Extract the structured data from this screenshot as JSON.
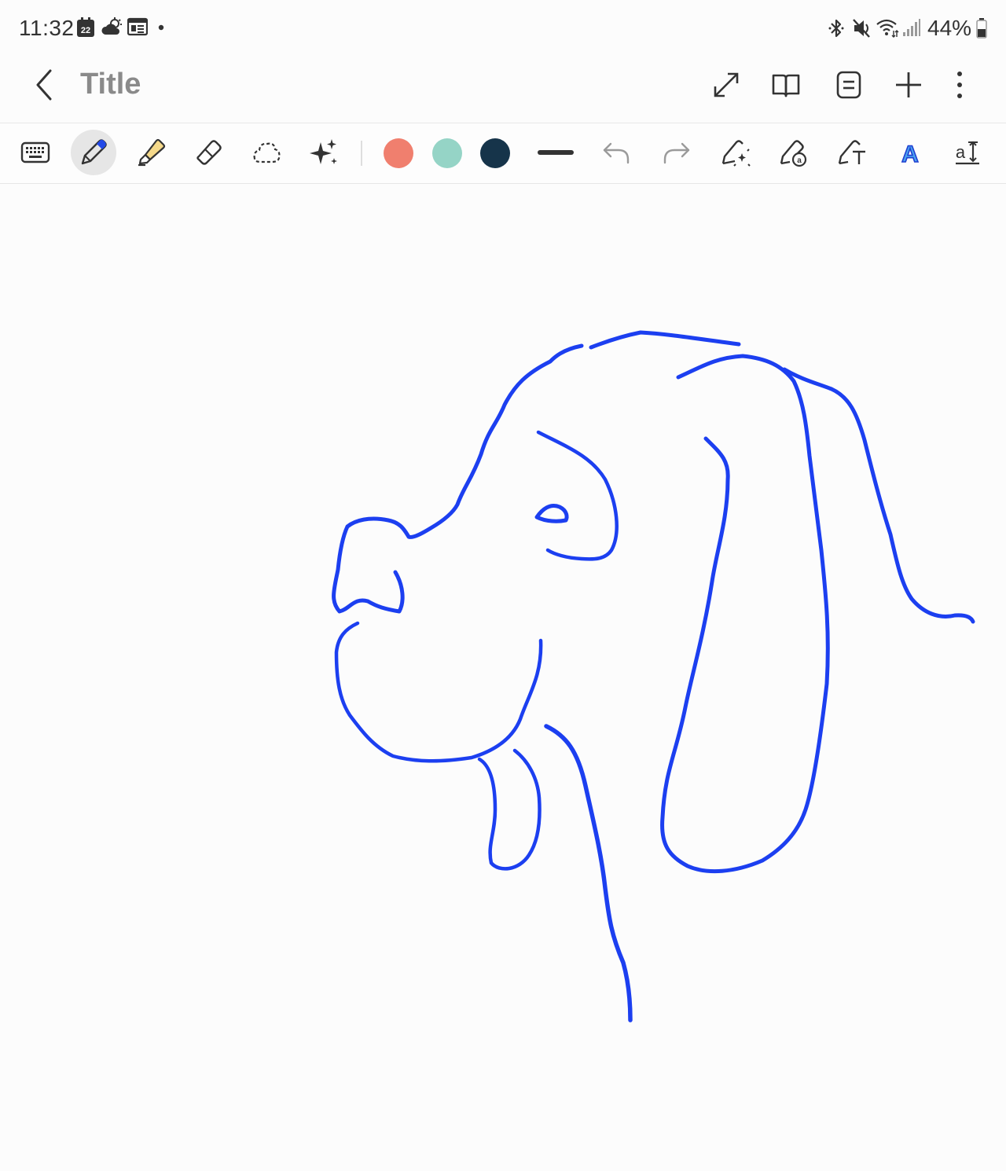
{
  "status_bar": {
    "time": "11:32",
    "calendar_day": "22",
    "battery_text": "44%"
  },
  "header": {
    "title": "Title"
  },
  "toolbar": {
    "colors": {
      "salmon": "#f07f6e",
      "mint": "#95d4c6",
      "navy": "#16344a"
    },
    "selected_tool": "pen",
    "accent_highlighter": "#f5d98a",
    "pen_tip_color": "#2249e8"
  },
  "drawing": {
    "stroke_color": "#1c3ff0",
    "subject": "dog-head-line-drawing"
  }
}
